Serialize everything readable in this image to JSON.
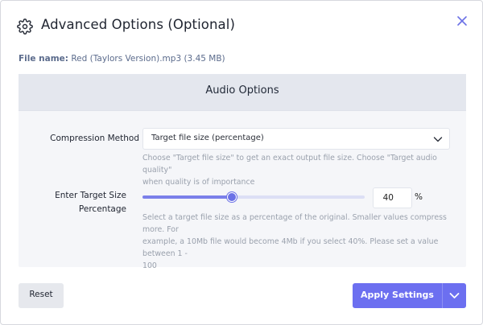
{
  "dialog": {
    "title": "Advanced Options (Optional)",
    "file_label": "File name:",
    "file_value": "Red (Taylors Version).mp3 (3.45 MB)"
  },
  "panel": {
    "title": "Audio Options"
  },
  "compression": {
    "label": "Compression Method",
    "selected": "Target file size (percentage)",
    "help_1": "Choose \"Target file size\" to get an exact output file size. Choose \"Target audio quality\"",
    "help_2": "when quality is of importance"
  },
  "target": {
    "label_1": "Enter Target Size",
    "label_2": "Percentage",
    "value": "40",
    "unit": "%",
    "slider_percent": 40,
    "help_1": "Select a target file size as a percentage of the original. Smaller values compress more. For",
    "help_2": "example, a 10Mb file would become 4Mb if you select 40%. Please set a value between 1 -",
    "help_3": "100"
  },
  "footer": {
    "reset_label": "Reset",
    "apply_label": "Apply Settings"
  },
  "icons": {
    "settings": "gear-icon",
    "close": "close-icon",
    "select_caret": "chevron-down-icon",
    "apply_caret": "chevron-down-icon"
  },
  "colors": {
    "accent": "#6c6ff0",
    "close_icon": "#6c72e6",
    "panel_bg": "#f5f6f9",
    "panel_header_bg": "#e4e7ee"
  }
}
